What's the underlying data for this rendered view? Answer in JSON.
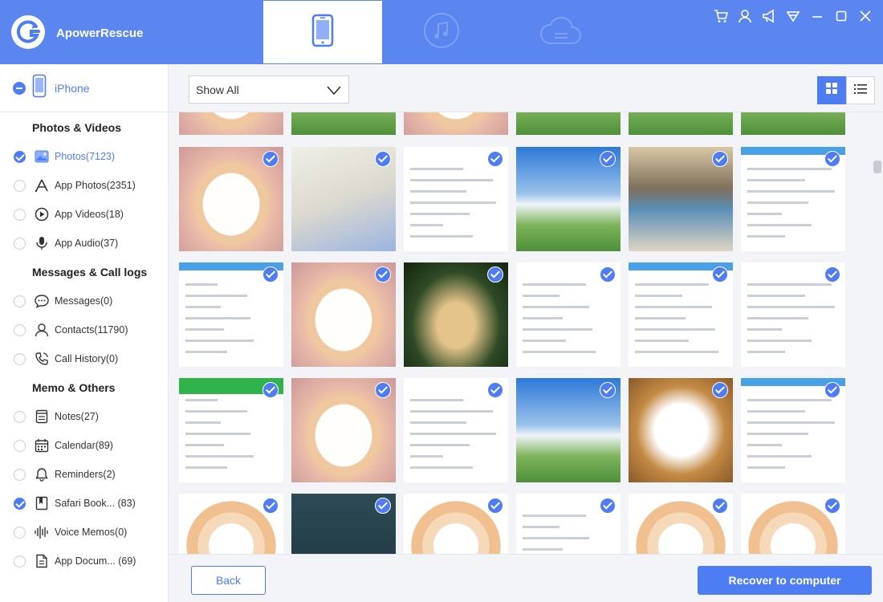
{
  "app": {
    "title": "ApowerRescue"
  },
  "header": {
    "tabs": [
      {
        "icon": "phone-icon",
        "active": true
      },
      {
        "icon": "music-icon",
        "active": false
      },
      {
        "icon": "cloud-icon",
        "active": false
      }
    ],
    "window_controls": [
      "cart-icon",
      "user-icon",
      "megaphone-icon",
      "menu-icon",
      "minimize-icon",
      "maximize-icon",
      "close-icon"
    ]
  },
  "sidebar": {
    "device": {
      "name": "iPhone"
    },
    "sections": [
      {
        "title": "Photos & Videos",
        "items": [
          {
            "label": "Photos(7123)",
            "icon": "photos-icon",
            "checked": true,
            "active": true
          },
          {
            "label": "App Photos(2351)",
            "icon": "app-photos-icon",
            "checked": false
          },
          {
            "label": "App Videos(18)",
            "icon": "play-icon",
            "checked": false
          },
          {
            "label": "App Audio(37)",
            "icon": "microphone-icon",
            "checked": false
          }
        ]
      },
      {
        "title": "Messages & Call logs",
        "items": [
          {
            "label": "Messages(0)",
            "icon": "message-icon",
            "checked": false
          },
          {
            "label": "Contacts(11790)",
            "icon": "contact-icon",
            "checked": false
          },
          {
            "label": "Call History(0)",
            "icon": "phone-call-icon",
            "checked": false
          }
        ]
      },
      {
        "title": "Memo & Others",
        "items": [
          {
            "label": "Notes(27)",
            "icon": "notes-icon",
            "checked": false
          },
          {
            "label": "Calendar(89)",
            "icon": "calendar-icon",
            "checked": false
          },
          {
            "label": "Reminders(2)",
            "icon": "bell-icon",
            "checked": false
          },
          {
            "label": "Safari Book... (83)",
            "icon": "bookmark-icon",
            "checked": true
          },
          {
            "label": "Voice Memos(0)",
            "icon": "waveform-icon",
            "checked": false
          },
          {
            "label": "App Docum... (69)",
            "icon": "document-icon",
            "checked": false
          }
        ]
      }
    ]
  },
  "toolbar": {
    "filter": {
      "selected": "Show All"
    },
    "view_modes": [
      "grid-view-icon",
      "list-view-icon"
    ],
    "active_view": "grid"
  },
  "grid": {
    "rows": [
      [
        "cat",
        "horse",
        "cat",
        "horse",
        "horse",
        "horse"
      ],
      [
        "cat",
        "cake",
        "ui",
        "horse",
        "penguin",
        "ui"
      ],
      [
        "ui",
        "cat",
        "dogs",
        "ui",
        "ui",
        "ui"
      ],
      [
        "ui-green",
        "cat",
        "ui",
        "horse",
        "bunny",
        "ui"
      ],
      [
        "cat2",
        "control-center",
        "cat2",
        "ui",
        "cat2",
        "cat2"
      ]
    ]
  },
  "footer": {
    "back_label": "Back",
    "recover_label": "Recover to computer"
  },
  "colors": {
    "accent": "#4e7cf2",
    "topbar": "#5b86f0",
    "panel": "#f2f4f8"
  }
}
